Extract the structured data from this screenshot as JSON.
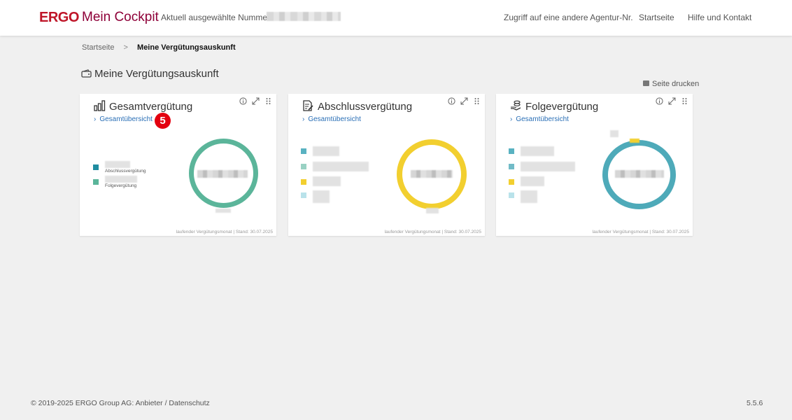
{
  "header": {
    "logo": "ERGO",
    "app_name": "Mein Cockpit",
    "number_label": "Aktuell ausgewählte Nummer:",
    "nav": [
      "Zugriff auf eine andere Agentur-Nr.",
      "Startseite",
      "Hilfe und Kontakt"
    ]
  },
  "breadcrumb": {
    "home": "Startseite",
    "separator": ">",
    "current": "Meine Vergütungsauskunft"
  },
  "page": {
    "title": "Meine Vergütungsauskunft",
    "print_label": "Seite drucken"
  },
  "cards": [
    {
      "title": "Gesamtvergütung",
      "link": "Gesamtübersicht",
      "legend": [
        "Abschlussvergütung",
        "Folgevergütung"
      ],
      "footer": "laufender Vergütungsmonat | Stand: 30.07.2025",
      "ring_color": "#5bb59a"
    },
    {
      "title": "Abschlussvergütung",
      "link": "Gesamtübersicht",
      "footer": "laufender Vergütungsmonat | Stand: 30.07.2025",
      "ring_color": "#f2cf2f"
    },
    {
      "title": "Folgevergütung",
      "link": "Gesamtübersicht",
      "footer": "laufender Vergütungsmonat | Stand: 30.07.2025",
      "ring_color": "#4eaab9"
    }
  ],
  "badge": "5",
  "footer": {
    "copyright": "© 2019-2025 ERGO Group AG: Anbieter / Datenschutz",
    "version": "5.5.6"
  },
  "colors": {
    "brand_red": "#bf1528",
    "link_blue": "#2a6fb6",
    "teal": "#1f8ca0",
    "green": "#5bb59a",
    "yellow": "#f2cf2f"
  }
}
